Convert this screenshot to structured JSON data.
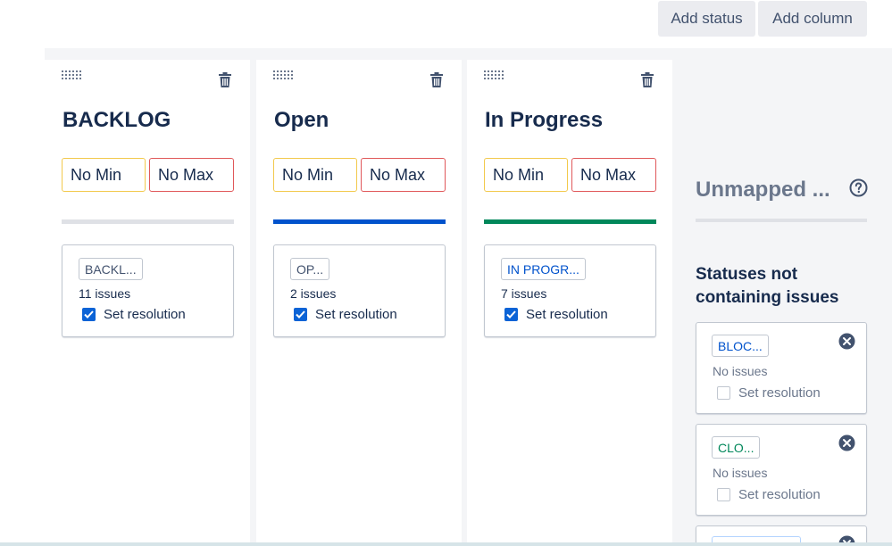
{
  "toolbar": {
    "add_status_label": "Add status",
    "add_column_label": "Add column"
  },
  "columns": [
    {
      "title": "BACKLOG",
      "min_label": "No Min",
      "max_label": "No Max",
      "bar_color": "#dfe1e6",
      "status": {
        "name": "BACKL...",
        "color": "#42526e",
        "issues": "11 issues",
        "resolution_label": "Set resolution",
        "resolution_checked": true
      }
    },
    {
      "title": "Open",
      "min_label": "No Min",
      "max_label": "No Max",
      "bar_color": "#0052cc",
      "status": {
        "name": "OP...",
        "color": "#42526e",
        "issues": "2 issues",
        "resolution_label": "Set resolution",
        "resolution_checked": true
      }
    },
    {
      "title": "In Progress",
      "min_label": "No Min",
      "max_label": "No Max",
      "bar_color": "#00875a",
      "status": {
        "name": "IN PROGR...",
        "color": "#0052cc",
        "issues": "7 issues",
        "resolution_label": "Set resolution",
        "resolution_checked": true
      }
    }
  ],
  "unmapped": {
    "title": "Unmapped ...",
    "subtitle": "Statuses not containing issues",
    "statuses": [
      {
        "name": "BLOC...",
        "color": "#0052cc",
        "issues": "No issues",
        "resolution_label": "Set resolution",
        "resolution_checked": false
      },
      {
        "name": "CLO...",
        "color": "#00875a",
        "issues": "No issues",
        "resolution_label": "Set resolution",
        "resolution_checked": false
      }
    ]
  },
  "icons": {
    "drag": "drag-handle-icon",
    "trash": "trash-icon",
    "help": "question-circle-icon",
    "remove": "remove-circle-icon",
    "check": "checkmark-icon"
  }
}
